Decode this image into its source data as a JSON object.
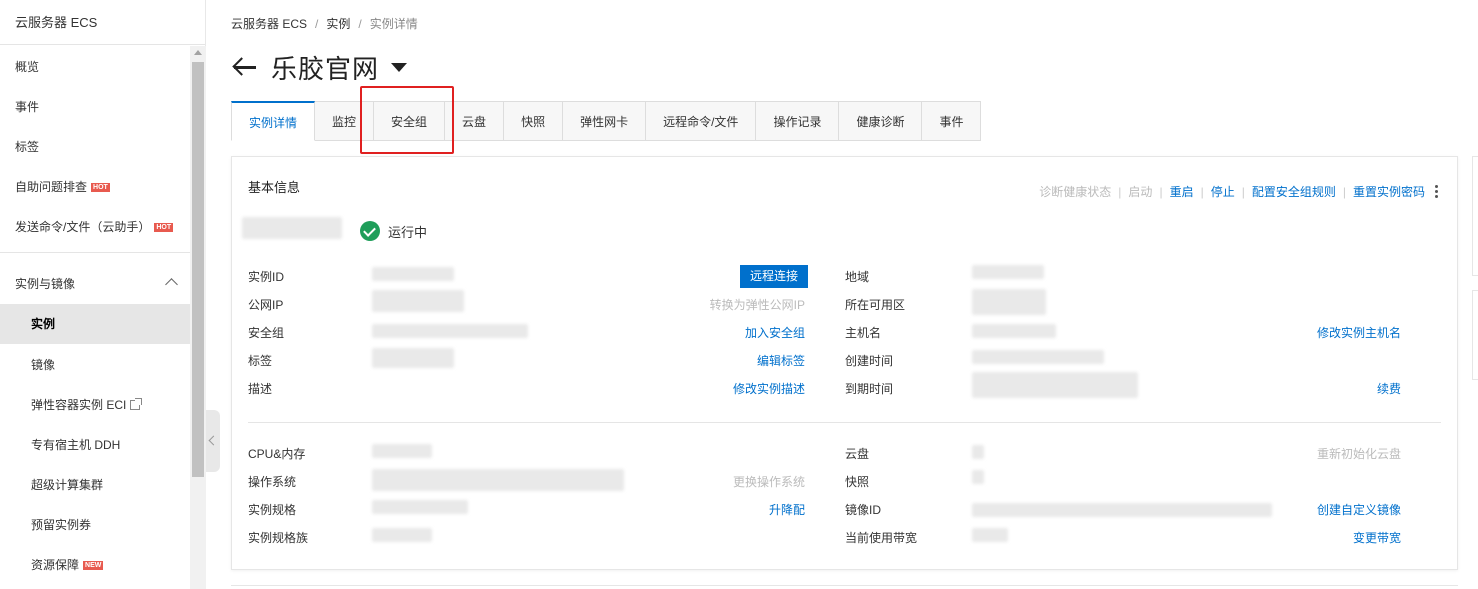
{
  "sidebar": {
    "title": "云服务器 ECS",
    "items": [
      {
        "label": "概览"
      },
      {
        "label": "事件"
      },
      {
        "label": "标签"
      },
      {
        "label": "自助问题排查",
        "badge": "HOT"
      },
      {
        "label": "发送命令/文件（云助手）",
        "badge": "HOT"
      }
    ],
    "group": {
      "label": "实例与镜像",
      "expanded": true
    },
    "subitems": [
      {
        "label": "实例",
        "active": true
      },
      {
        "label": "镜像"
      },
      {
        "label": "弹性容器实例 ECI",
        "external": true
      },
      {
        "label": "专有宿主机 DDH"
      },
      {
        "label": "超级计算集群"
      },
      {
        "label": "预留实例券"
      },
      {
        "label": "资源保障",
        "badge": "NEW"
      }
    ]
  },
  "breadcrumb": [
    "云服务器 ECS",
    "实例",
    "实例详情"
  ],
  "page_title": "乐胶官网",
  "tabs": [
    "实例详情",
    "监控",
    "安全组",
    "云盘",
    "快照",
    "弹性网卡",
    "远程命令/文件",
    "操作记录",
    "健康诊断",
    "事件"
  ],
  "active_tab": "实例详情",
  "highlighted_tab": "安全组",
  "panel": {
    "title": "基本信息",
    "actions": [
      {
        "label": "诊断健康状态",
        "enabled": false
      },
      {
        "label": "启动",
        "enabled": false
      },
      {
        "label": "重启",
        "enabled": true
      },
      {
        "label": "停止",
        "enabled": true
      },
      {
        "label": "配置安全组规则",
        "enabled": true
      },
      {
        "label": "重置实例密码",
        "enabled": true
      }
    ],
    "status": "运行中",
    "remote_connect": "远程连接",
    "left_fields": [
      {
        "label": "实例ID",
        "action": ""
      },
      {
        "label": "公网IP",
        "action": "转换为弹性公网IP",
        "action_enabled": false
      },
      {
        "label": "安全组",
        "action": "加入安全组"
      },
      {
        "label": "标签",
        "action": "编辑标签"
      },
      {
        "label": "描述",
        "action": "修改实例描述"
      }
    ],
    "right_fields": [
      {
        "label": "地域",
        "action": ""
      },
      {
        "label": "所在可用区",
        "action": ""
      },
      {
        "label": "主机名",
        "action": "修改实例主机名"
      },
      {
        "label": "创建时间",
        "action": ""
      },
      {
        "label": "到期时间",
        "action": "续费"
      }
    ],
    "left_fields2": [
      {
        "label": "CPU&内存",
        "action": ""
      },
      {
        "label": "操作系统",
        "action": "更换操作系统",
        "action_enabled": false
      },
      {
        "label": "实例规格",
        "action": "升降配"
      },
      {
        "label": "实例规格族",
        "action": ""
      }
    ],
    "right_fields2": [
      {
        "label": "云盘",
        "action": "重新初始化云盘",
        "action_enabled": false
      },
      {
        "label": "快照",
        "action": ""
      },
      {
        "label": "镜像ID",
        "action": "创建自定义镜像"
      },
      {
        "label": "当前使用带宽",
        "action": "变更带宽"
      }
    ]
  },
  "colors": {
    "accent": "#0070cc",
    "success": "#1f9e5a",
    "highlight": "#e02020",
    "badge": "#e85a4f"
  }
}
